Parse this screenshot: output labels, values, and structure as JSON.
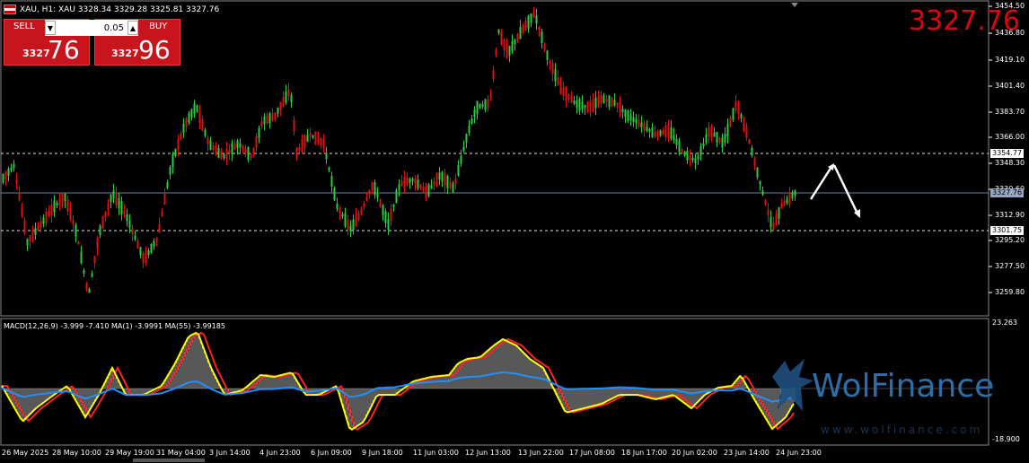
{
  "header": {
    "symbol_line": "XAU, H1:  XAU  3328.34 3329.28 3325.81 3327.76"
  },
  "big_price": "3327.76",
  "trade_panel": {
    "sell_label": "SELL",
    "buy_label": "BUY",
    "lot": "0.05",
    "lot_down": "▼",
    "lot_up": "▲",
    "sell_small": "3327",
    "sell_large": "76",
    "buy_small": "3327",
    "buy_large": "96"
  },
  "price_axis": [
    "3454.50",
    "3436.80",
    "3419.10",
    "3401.40",
    "3383.70",
    "3366.00",
    "3348.30",
    "3330.60",
    "3312.90",
    "3295.20",
    "3277.50",
    "3259.80"
  ],
  "price_boxes": {
    "upper_line": "3354.77",
    "current": "3327.76",
    "lower_line": "3301.75"
  },
  "macd": {
    "label": "MACD(12,26,9) -3.999 -7.410 MA(1) -3.9991 MA(55) -3.99185",
    "axis_top": "23.263",
    "axis_bottom": "-18.900"
  },
  "time_axis": [
    "26 May 2025",
    "28 May 10:00",
    "29 May 19:00",
    "31 May 04:00",
    "3 Jun 14:00",
    "4 Jun 23:00",
    "6 Jun 09:00",
    "9 Jun 18:00",
    "11 Jun 03:00",
    "12 Jun 13:00",
    "13 Jun 22:00",
    "17 Jun 08:00",
    "18 Jun 17:00",
    "20 Jun 02:00",
    "23 Jun 14:00",
    "24 Jun 23:00"
  ],
  "watermark": {
    "brand": "WolFinance",
    "site": "www.wolfinance.com"
  },
  "colors": {
    "bull": "#2ecc40",
    "bear": "#e01010",
    "signal": "#ff2020",
    "macd_line": "#ffff00",
    "ma": "#1e90ff",
    "price_line": "#6b7fa8"
  }
}
